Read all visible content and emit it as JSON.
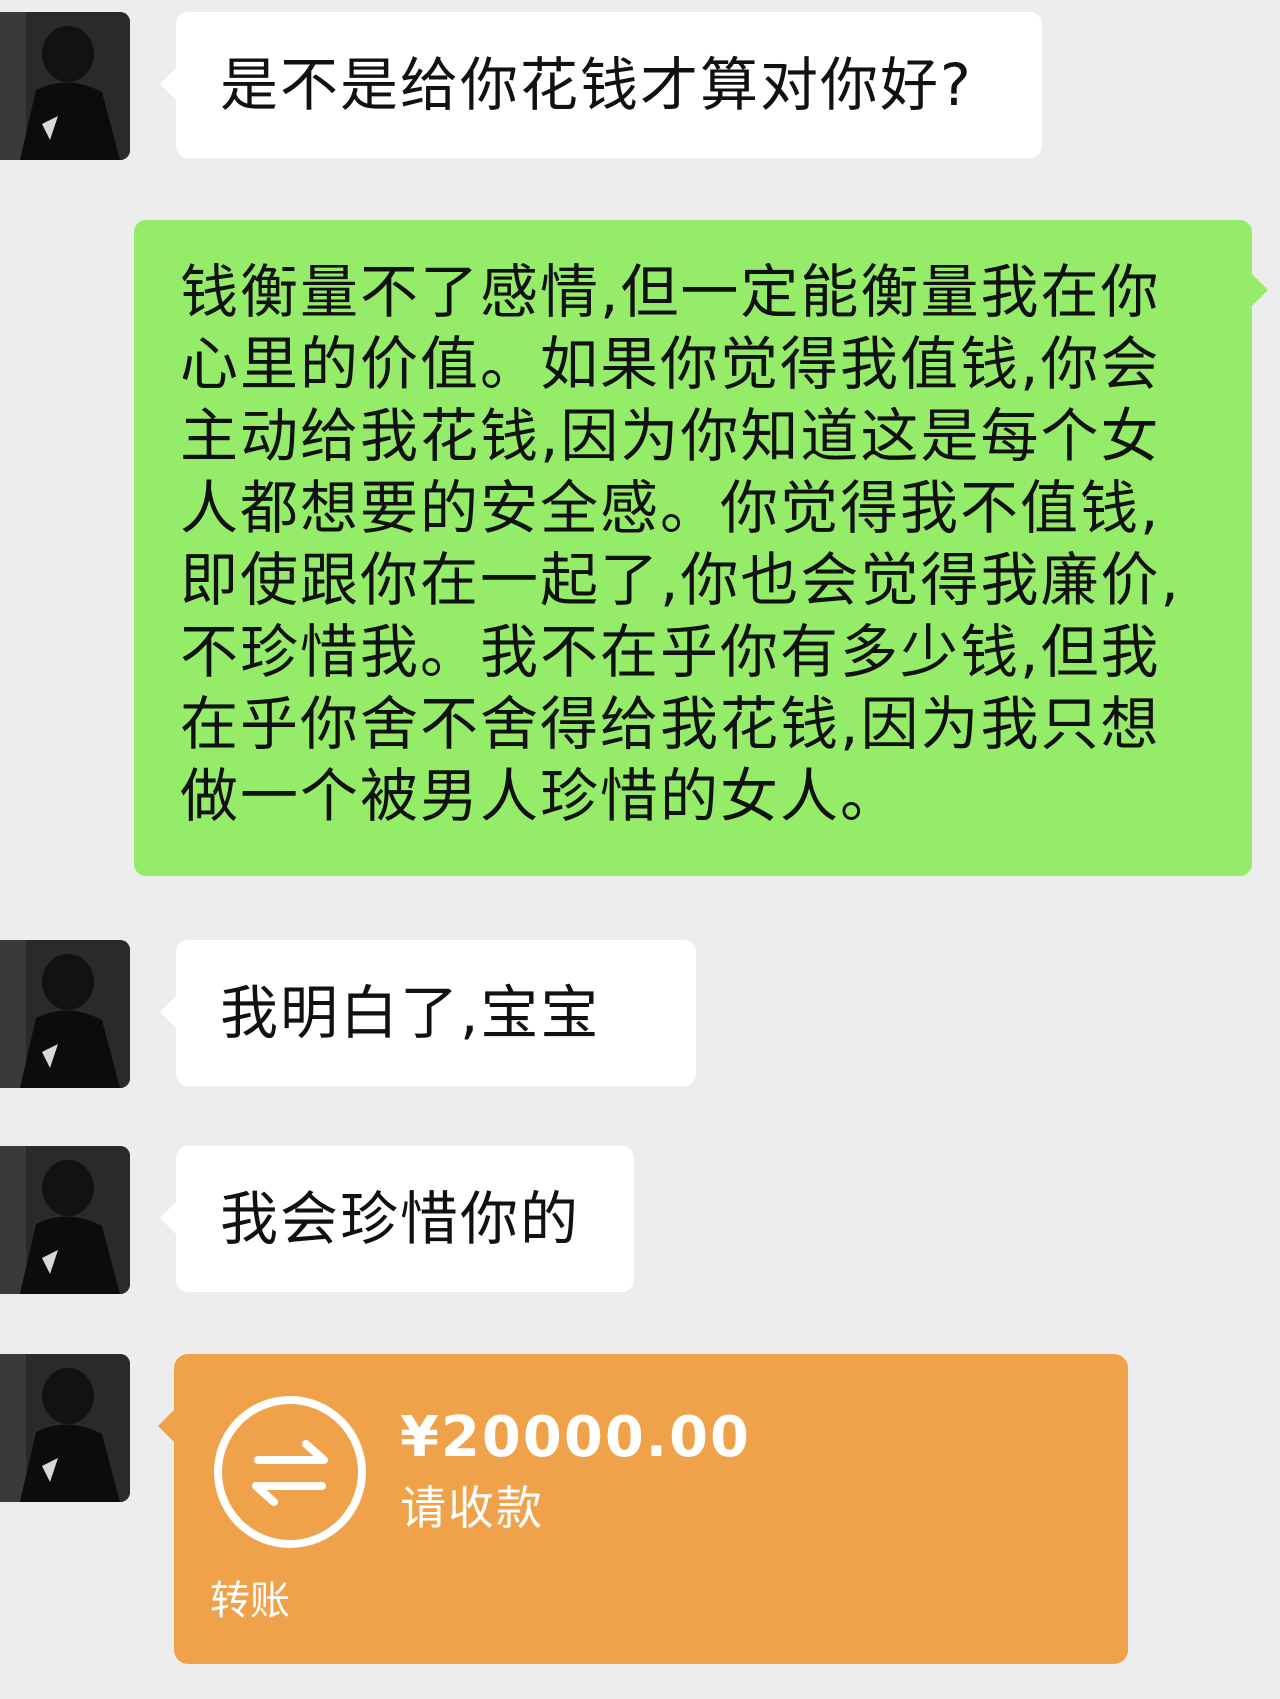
{
  "messages": [
    {
      "side": "left",
      "text": "是不是给你花钱才算对你好?"
    },
    {
      "side": "right",
      "lines": [
        "钱衡量不了感情,但一定能衡量我在你",
        "心里的价值。如果你觉得我值钱,你会",
        "主动给我花钱,因为你知道这是每个女",
        "人都想要的安全感。你觉得我不值钱,",
        "即使跟你在一起了,你也会觉得我廉价,",
        "不珍惜我。我不在乎你有多少钱,但我",
        "在乎你舍不舍得给我花钱,因为我只想",
        "做一个被男人珍惜的女人。"
      ]
    },
    {
      "side": "left",
      "text": "我明白了,宝宝"
    },
    {
      "side": "left",
      "text": "我会珍惜你的"
    }
  ],
  "transfer": {
    "amount": "¥20000.00",
    "status": "请收款",
    "label": "转账",
    "icon": "transfer-arrows-icon"
  },
  "colors": {
    "background": "#ededed",
    "incoming_bubble": "#ffffff",
    "outgoing_bubble": "#95ec69",
    "transfer_card": "#f0a24a"
  }
}
